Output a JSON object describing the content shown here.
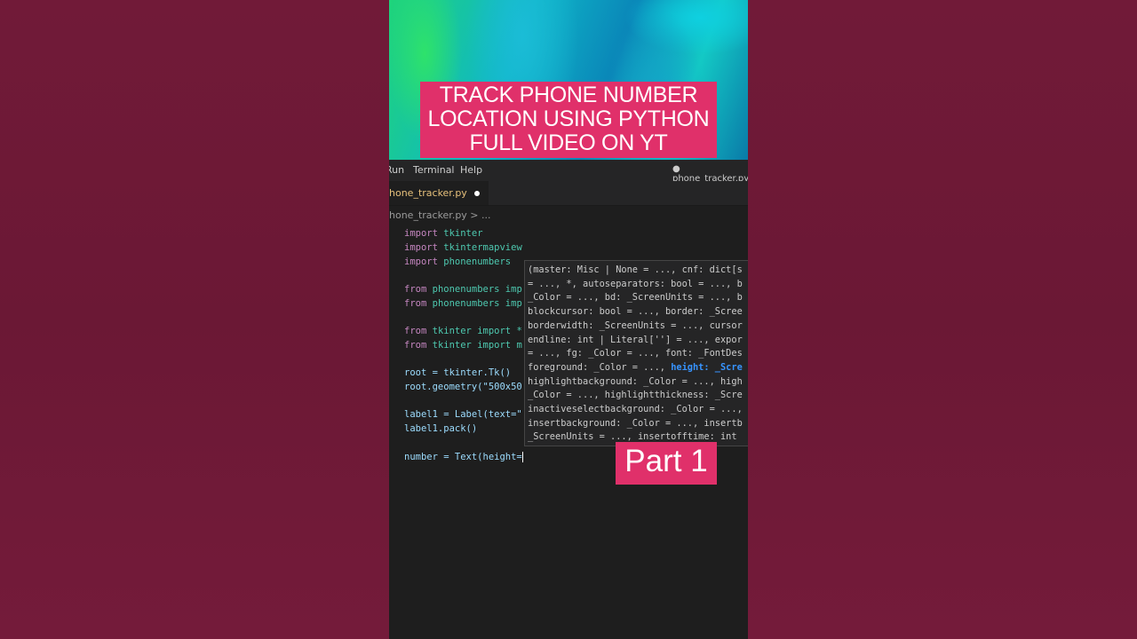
{
  "banner": {
    "lines": [
      "TRACK PHONE NUMBER",
      "LOCATION USING PYTHON",
      "FULL VIDEO ON YT"
    ]
  },
  "menubar": {
    "items": [
      "Run",
      "Terminal",
      "Help"
    ],
    "window_title": "● phone_tracker.py"
  },
  "tab": {
    "filename": "hone_tracker.py"
  },
  "breadcrumb": {
    "path": "hone_tracker.py > ..."
  },
  "code": {
    "lines": [
      {
        "k": "import",
        "r": " tkinter"
      },
      {
        "k": "import",
        "r": " tkintermapview"
      },
      {
        "k": "import",
        "r": " phonenumbers"
      },
      {
        "k": "",
        "r": ""
      },
      {
        "k": "from",
        "r": " phonenumbers imp"
      },
      {
        "k": "from",
        "r": " phonenumbers imp"
      },
      {
        "k": "",
        "r": ""
      },
      {
        "k": "from",
        "r": " tkinter import *"
      },
      {
        "k": "from",
        "r": " tkinter import m"
      },
      {
        "k": "",
        "r": ""
      },
      {
        "k": "",
        "r": "root = tkinter.Tk()"
      },
      {
        "k": "",
        "r": "root.geometry(\"500x50"
      },
      {
        "k": "",
        "r": ""
      },
      {
        "k": "",
        "r": "label1 = Label(text=\""
      },
      {
        "k": "",
        "r": "label1.pack()"
      },
      {
        "k": "",
        "r": ""
      },
      {
        "k": "",
        "r": "number = Text(height="
      }
    ]
  },
  "signature_hint": {
    "lines": [
      "(master: Misc | None = ..., cnf: dict[s",
      "= ..., *, autoseparators: bool = ..., b",
      "_Color = ..., bd: _ScreenUnits = ..., b",
      "blockcursor: bool = ..., border: _Scree",
      "borderwidth: _ScreenUnits = ..., cursor",
      "endline: int | Literal[''] = ..., expor",
      "= ..., fg: _Color = ..., font: _FontDes",
      "foreground: _Color = ..., ",
      "highlightbackground: _Color = ..., high",
      "_Color = ..., highlightthickness: _Scre",
      "inactiveselectbackground: _Color = ...,",
      "insertbackground: _Color = ..., insertb",
      "_ScreenUnits = ..., insertofftime: int"
    ],
    "highlight_text": "height: _Scre"
  },
  "part_label": "Part 1",
  "colors": {
    "accent": "#e0306a",
    "background": "#6f1a37",
    "editor_bg": "#1e1e1e"
  }
}
